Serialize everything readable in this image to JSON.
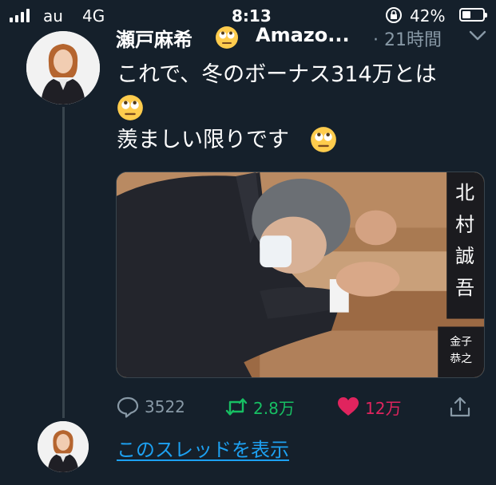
{
  "status_bar": {
    "carrier": "au",
    "network": "4G",
    "time": "8:13",
    "battery_percent": "42%",
    "battery_level": 0.42,
    "icons": [
      "signal-icon",
      "rotation-lock-icon",
      "battery-icon"
    ]
  },
  "tweet": {
    "display_name": "瀬戸麻希",
    "handle": "Amazo...",
    "time_ago": "· 21時間",
    "text_line1": "これで、冬のボーナス314万とは",
    "text_line3": "羨ましい限りです",
    "emoji": "face-with-rolling-eyes",
    "media": {
      "nameplate_top": "北村誠吾",
      "nameplate_bottom": "金子恭之"
    },
    "actions": {
      "reply_count": "3522",
      "retweet_count": "2.8万",
      "like_count": "12万"
    },
    "colors": {
      "retweet": "#17bf63",
      "like": "#e0245e",
      "link": "#1da1f2",
      "background": "#15202b"
    }
  },
  "thread": {
    "show_thread_label": "このスレッドを表示"
  }
}
